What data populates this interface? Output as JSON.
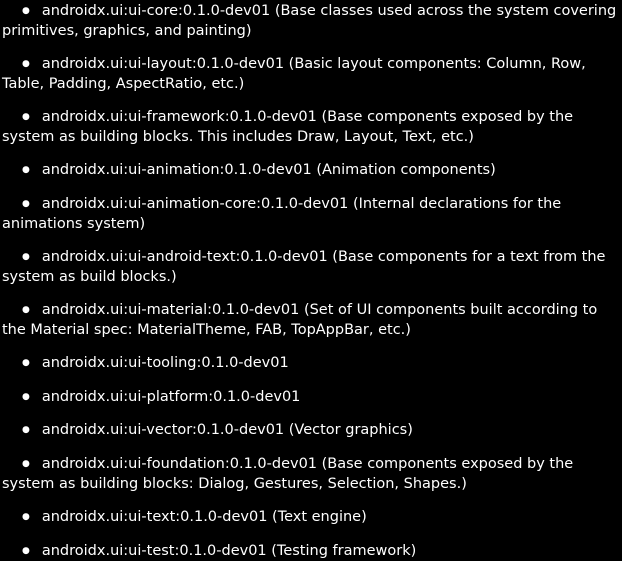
{
  "items": [
    {
      "artifact": "androidx.ui:ui-core:0.1.0-dev01",
      "desc": "(Base classes used across the system covering primitives, graphics, and painting)"
    },
    {
      "artifact": "androidx.ui:ui-layout:0.1.0-dev01",
      "desc": "(Basic layout components: Column, Row, Table, Padding, AspectRatio, etc.)"
    },
    {
      "artifact": "androidx.ui:ui-framework:0.1.0-dev01",
      "desc": "(Base components exposed by the system as building blocks. This includes Draw, Layout, Text, etc.)"
    },
    {
      "artifact": "androidx.ui:ui-animation:0.1.0-dev01",
      "desc": "(Animation components)"
    },
    {
      "artifact": "androidx.ui:ui-animation-core:0.1.0-dev01",
      "desc": "(Internal declarations for the animations system)"
    },
    {
      "artifact": "androidx.ui:ui-android-text:0.1.0-dev01",
      "desc": "(Base components for a text from the system as build blocks.)"
    },
    {
      "artifact": "androidx.ui:ui-material:0.1.0-dev01",
      "desc": "(Set of UI components built according to the Material spec: MaterialTheme, FAB, TopAppBar, etc.)"
    },
    {
      "artifact": "androidx.ui:ui-tooling:0.1.0-dev01",
      "desc": ""
    },
    {
      "artifact": "androidx.ui:ui-platform:0.1.0-dev01",
      "desc": ""
    },
    {
      "artifact": "androidx.ui:ui-vector:0.1.0-dev01",
      "desc": "(Vector graphics)"
    },
    {
      "artifact": "androidx.ui:ui-foundation:0.1.0-dev01",
      "desc": "(Base components exposed by the system as building blocks:  Dialog, Gestures, Selection, Shapes.)"
    },
    {
      "artifact": "androidx.ui:ui-text:0.1.0-dev01",
      "desc": "(Text engine)"
    },
    {
      "artifact": "androidx.ui:ui-test:0.1.0-dev01",
      "desc": "(Testing framework)"
    }
  ]
}
